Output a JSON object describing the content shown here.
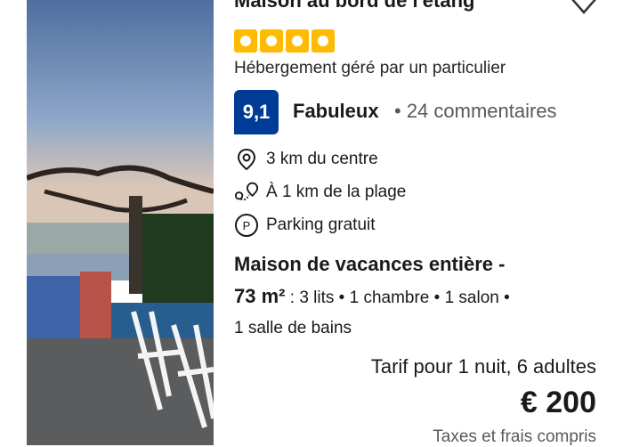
{
  "listing": {
    "title": "Maison au bord de l'étang",
    "star_count": 4,
    "host_type": "Hébergement géré par un particulier",
    "score": "9,1",
    "score_label": "Fabuleux",
    "reviews": "• 24 commentaires",
    "features": [
      {
        "icon": "location-pin-icon",
        "label": "3 km du centre"
      },
      {
        "icon": "beach-distance-icon",
        "label": "À 1 km de la plage"
      },
      {
        "icon": "parking-icon",
        "label": "Parking gratuit"
      }
    ],
    "unit_type": "Maison de vacances entière -",
    "unit_size": "73 m²",
    "unit_details_1": " : 3 lits • 1 chambre • 1 salon •",
    "unit_details_2": "1 salle de bains",
    "price_for": "Tarif pour 1 nuit, 6 adultes",
    "price": "€ 200",
    "taxes": "Taxes et frais compris"
  },
  "colors": {
    "score_badge": "#003b95",
    "stars": "#febb02"
  }
}
